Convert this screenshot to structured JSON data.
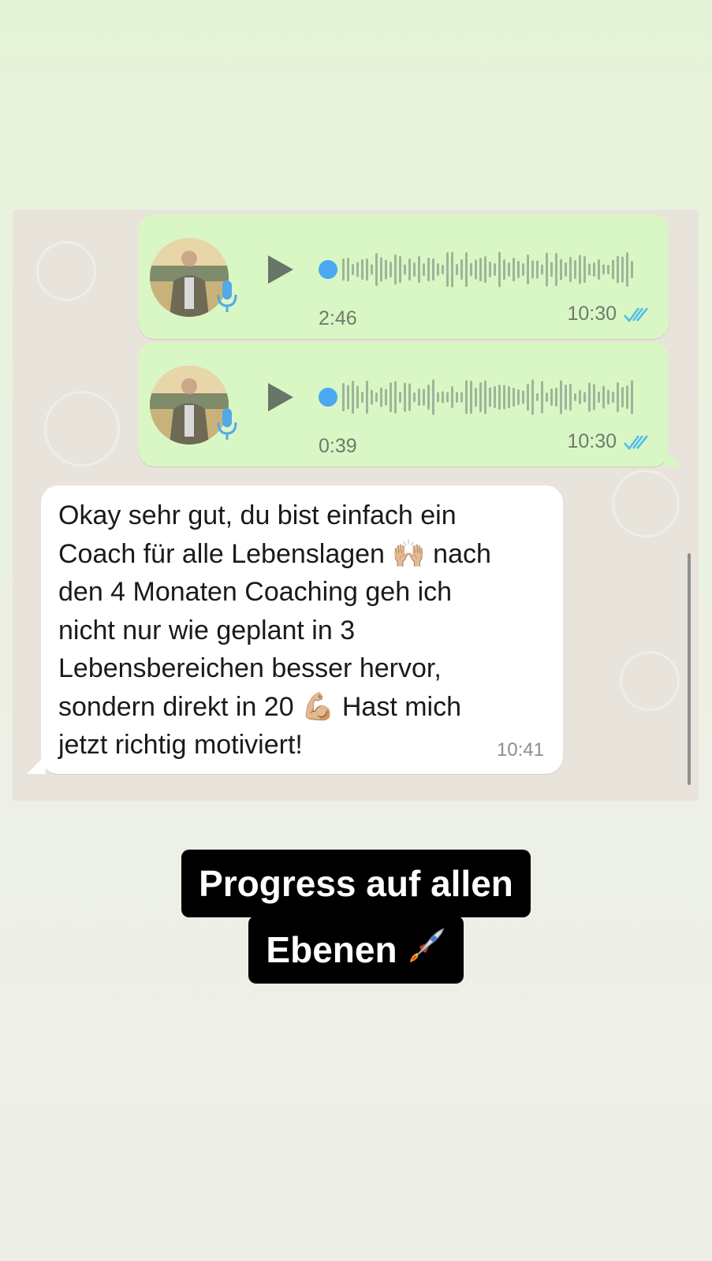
{
  "chat": {
    "voice_messages": [
      {
        "duration": "2:46",
        "time": "10:30",
        "status_icon": "double-check-icon",
        "status_color": "#53bdeb"
      },
      {
        "duration": "0:39",
        "time": "10:30",
        "status_icon": "double-check-icon",
        "status_color": "#53bdeb"
      }
    ],
    "incoming": {
      "text": "Okay sehr gut, du bist einfach ein\nCoach für alle Lebenslagen 🙌🏼 nach\nden 4 Monaten Coaching geh ich\nnicht nur wie geplant in 3\nLebensbereichen besser hervor,\nsondern direkt in 20 💪🏼 Hast mich\njetzt richtig motiviert!",
      "time": "10:41"
    }
  },
  "caption": {
    "line1": "Progress auf allen",
    "line2": "Ebenen",
    "icon": "rocket-icon"
  },
  "colors": {
    "outgoing_bubble": "#d9f7c4",
    "incoming_bubble": "#ffffff",
    "play_dot": "#4aa8f0",
    "waveform": "#9fb49a"
  }
}
